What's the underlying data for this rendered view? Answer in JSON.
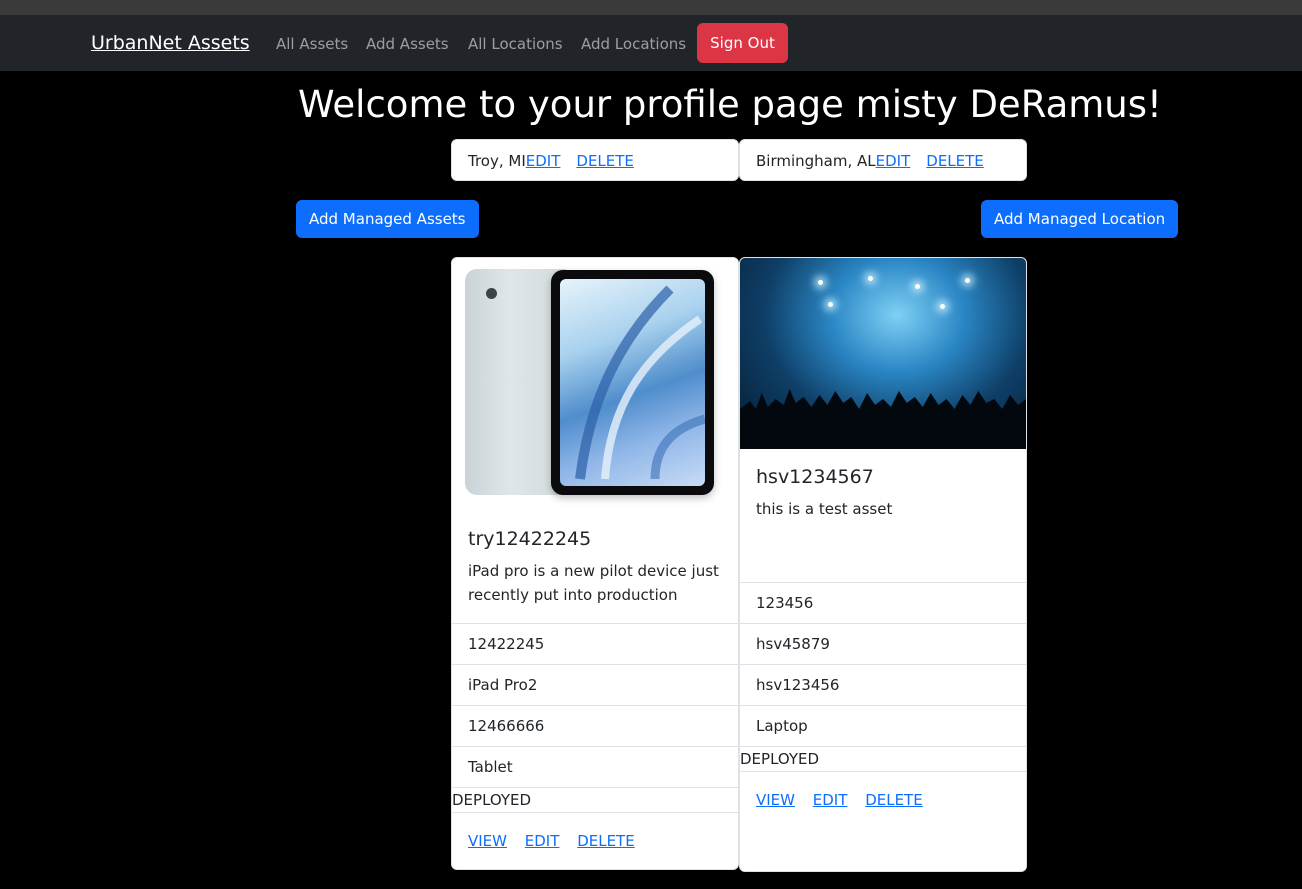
{
  "nav": {
    "brand": "UrbanNet Assets",
    "links": [
      "All Assets",
      "Add Assets",
      "All Locations",
      "Add Locations"
    ],
    "signout": "Sign Out"
  },
  "welcome": "Welcome to your profile page misty DeRamus!",
  "locations": [
    {
      "name": "Troy, MI",
      "edit": "EDIT",
      "delete": "DELETE"
    },
    {
      "name": "Birmingham, AL",
      "edit": "EDIT",
      "delete": "DELETE"
    }
  ],
  "buttons": {
    "add_assets": "Add Managed Assets",
    "add_location": "Add Managed Location"
  },
  "assets": [
    {
      "title": "try12422245",
      "description": "iPad pro is a new pilot device just recently put into production",
      "fields": [
        "12422245",
        "iPad Pro2",
        "12466666",
        "Tablet"
      ],
      "status": "DEPLOYED",
      "view": "VIEW",
      "edit": "EDIT",
      "delete": "DELETE",
      "image": "ipad-image"
    },
    {
      "title": "hsv1234567",
      "description": "this is a test asset",
      "fields": [
        "123456",
        "hsv45879",
        "hsv123456",
        "Laptop"
      ],
      "status": "DEPLOYED",
      "view": "VIEW",
      "edit": "EDIT",
      "delete": "DELETE",
      "image": "concert-image"
    }
  ],
  "colors": {
    "navbar": "#212529",
    "danger": "#dc3545",
    "primary": "#0d6efd",
    "link": "#0d6efd"
  }
}
